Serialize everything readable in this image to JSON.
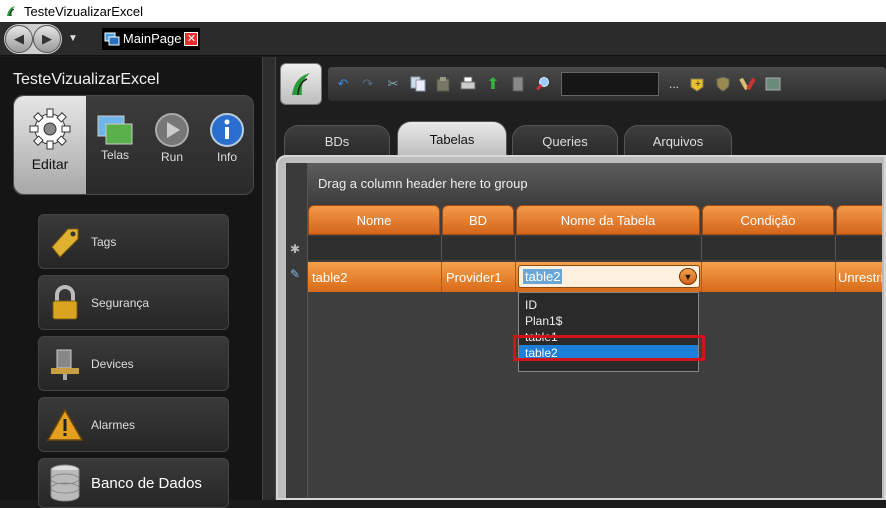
{
  "window": {
    "title": "TesteVizualizarExcel"
  },
  "nav": {
    "page_tab": "MainPage"
  },
  "left": {
    "title": "TesteVizualizarExcel",
    "tools": [
      {
        "label": "Editar",
        "icon": "gear-icon"
      },
      {
        "label": "Telas",
        "icon": "screens-icon"
      },
      {
        "label": "Run",
        "icon": "play-icon"
      },
      {
        "label": "Info",
        "icon": "info-icon"
      }
    ],
    "items": [
      {
        "label": "Tags",
        "icon": "tag-icon"
      },
      {
        "label": "Segurança",
        "icon": "lock-icon"
      },
      {
        "label": "Devices",
        "icon": "device-icon"
      },
      {
        "label": "Alarmes",
        "icon": "warning-icon"
      },
      {
        "label": "Banco de Dados",
        "icon": "database-icon"
      }
    ]
  },
  "toolbar": {
    "more_label": "..."
  },
  "tabs": [
    {
      "label": "BDs"
    },
    {
      "label": "Tabelas",
      "active": true
    },
    {
      "label": "Queries"
    },
    {
      "label": "Arquivos"
    }
  ],
  "grid": {
    "group_hint": "Drag a column header here to group",
    "columns": [
      "Nome",
      "BD",
      "Nome da Tabela",
      "Condição",
      ""
    ],
    "row": {
      "nome": "table2",
      "bd": "Provider1",
      "tabela": "table2",
      "condicao": "",
      "extra": "Unrestric"
    },
    "dropdown_options": [
      "ID",
      "Plan1$",
      "table1",
      "table2"
    ],
    "dropdown_selected": "table2"
  },
  "colors": {
    "header_orange": "#e07a2a",
    "selection_blue": "#1e7fd8",
    "highlight_red": "#d0141a"
  }
}
